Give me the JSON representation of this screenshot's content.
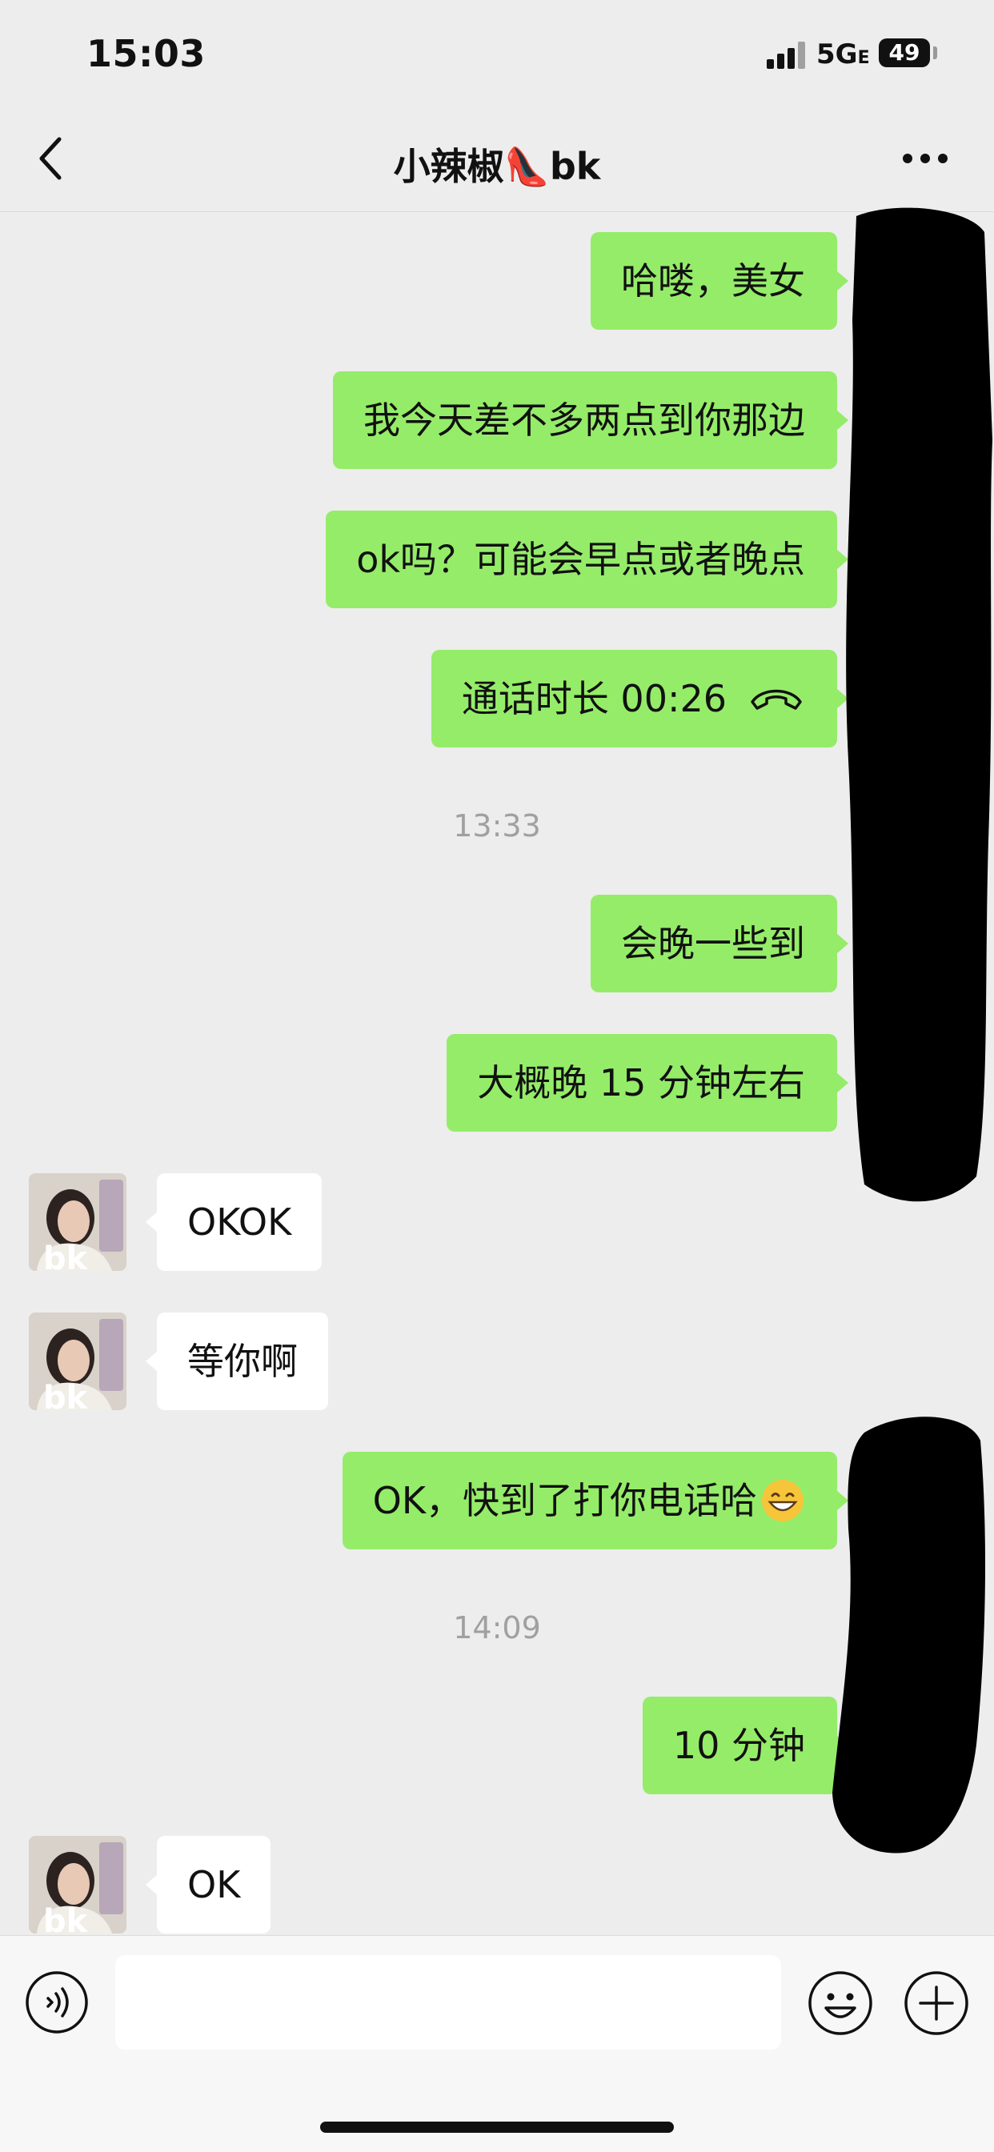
{
  "status_bar": {
    "time": "15:03",
    "network": "5G",
    "network_sub": "E",
    "battery": "49"
  },
  "header": {
    "title": "小辣椒👠bk",
    "back_icon": "chevron-left-icon",
    "more_icon": "ellipsis-icon"
  },
  "messages": [
    {
      "direction": "out",
      "text": "哈喽，美女"
    },
    {
      "direction": "out",
      "text": "我今天差不多两点到你那边"
    },
    {
      "direction": "out",
      "text": "ok吗？可能会早点或者晚点"
    },
    {
      "direction": "out",
      "text": "通话时长 00:26",
      "icon": "phone-hangup-icon"
    },
    {
      "type": "timestamp",
      "text": "13:33"
    },
    {
      "direction": "out",
      "text": "会晚一些到"
    },
    {
      "direction": "out",
      "text": "大概晚 15 分钟左右"
    },
    {
      "direction": "in",
      "text": "OKOK"
    },
    {
      "direction": "in",
      "text": "等你啊"
    },
    {
      "direction": "out",
      "text": "OK，快到了打你电话哈",
      "emoji": "grinning-face-icon"
    },
    {
      "type": "timestamp",
      "text": "14:09"
    },
    {
      "direction": "out",
      "text": "10 分钟"
    },
    {
      "direction": "in",
      "text": "OK"
    }
  ],
  "input_bar": {
    "voice_icon": "voice-icon",
    "text_value": "",
    "emoji_icon": "smiley-icon",
    "plus_icon": "plus-icon"
  },
  "colors": {
    "outgoing_bubble": "#95ec69",
    "incoming_bubble": "#ffffff",
    "background": "#ededed"
  }
}
